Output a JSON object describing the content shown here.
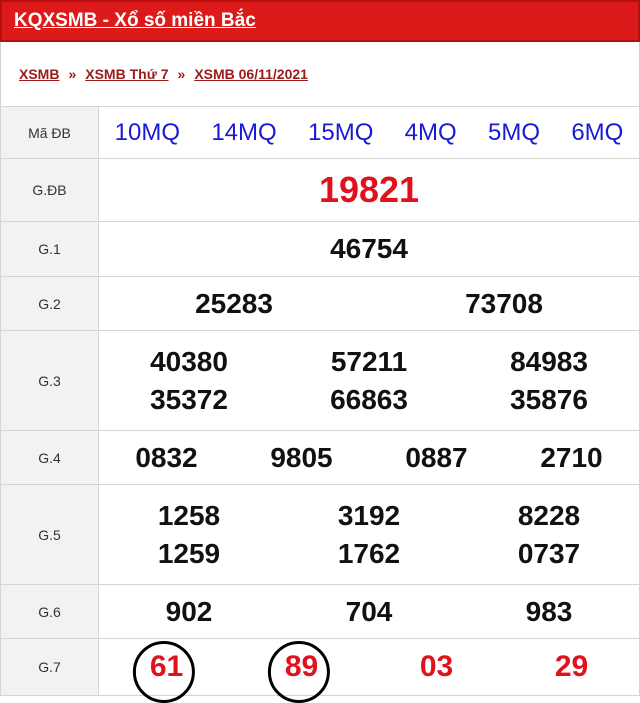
{
  "header": {
    "title": "KQXSMB - Xổ số miền Bắc"
  },
  "breadcrumb": {
    "items": [
      "XSMB",
      "XSMB Thứ 7",
      "XSMB 06/11/2021"
    ],
    "separator": "»"
  },
  "colors": {
    "header_bg": "#dd1a1a",
    "crumb": "#9b1a1a",
    "red_number": "#e0131d",
    "code_blue": "#1a1ad6"
  },
  "table": {
    "ma_db": {
      "label": "Mã ĐB",
      "codes": [
        "10MQ",
        "14MQ",
        "15MQ",
        "4MQ",
        "5MQ",
        "6MQ"
      ]
    },
    "gdb": {
      "label": "G.ĐB",
      "numbers": [
        "19821"
      ]
    },
    "g1": {
      "label": "G.1",
      "numbers": [
        "46754"
      ]
    },
    "g2": {
      "label": "G.2",
      "numbers": [
        "25283",
        "73708"
      ]
    },
    "g3": {
      "label": "G.3",
      "numbers": [
        "40380",
        "57211",
        "84983",
        "35372",
        "66863",
        "35876"
      ]
    },
    "g4": {
      "label": "G.4",
      "numbers": [
        "0832",
        "9805",
        "0887",
        "2710"
      ]
    },
    "g5": {
      "label": "G.5",
      "numbers": [
        "1258",
        "3192",
        "8228",
        "1259",
        "1762",
        "0737"
      ]
    },
    "g6": {
      "label": "G.6",
      "numbers": [
        "902",
        "704",
        "983"
      ]
    },
    "g7": {
      "label": "G.7",
      "numbers": [
        "61",
        "89",
        "03",
        "29"
      ]
    }
  }
}
